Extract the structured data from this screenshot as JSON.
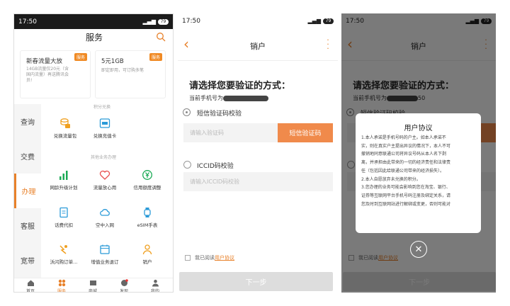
{
  "status": {
    "time": "17:50",
    "signal": "4G",
    "battery": "79"
  },
  "services": {
    "title": "服务",
    "promo1": {
      "title": "新春流量大放",
      "tag": "服务",
      "desc_line1": "14GB流量仅20元（含",
      "desc_line2": "国内流量）再送腾讯会",
      "desc_line3": "员!"
    },
    "promo2": {
      "title": "5元1GB",
      "tag": "服务",
      "desc": "即定即用，可订购多笔"
    },
    "nav": [
      "查询",
      "交费",
      "办理",
      "客服",
      "宽带"
    ],
    "sections": {
      "points": "积分兑换",
      "other": "其他业务办理"
    },
    "points_items": [
      "兑换流量包",
      "兑换充值卡"
    ],
    "items_row1": [
      "网龄升级计划",
      "流量放心用",
      "信用额度调整"
    ],
    "items_row2": [
      "话费代扣",
      "空中入网",
      "eSIM手表"
    ],
    "items_row3": [
      "沃闪购订单...",
      "增值业务退订",
      "销户"
    ],
    "tabs": [
      "首页",
      "服务",
      "商城",
      "发现",
      "我的"
    ]
  },
  "cancel": {
    "title": "销户",
    "question": "请选择您要验证的方式：",
    "phone_prefix": "当前手机号为",
    "phone_suffix": "50",
    "sms_option": "短信验证码校验",
    "sms_placeholder": "请输入验证码",
    "sms_button": "短信验证码",
    "iccid_option": "ICCID码校验",
    "iccid_placeholder": "请输入ICCID码校验",
    "agree_prefix": "我已阅读",
    "agree_link": "用户协议",
    "next": "下一步"
  },
  "dialog": {
    "title": "用户协议",
    "lines": [
      "1.本人承诺是手机号码的户主。如本人承诺不",
      "实，则在真实户主提出异议的情况下，本人不可",
      "撤销地同意联通公司将异议号码从本人名下剥",
      "离，并承担由此带来的一切的经济责任和法律责",
      "任（包括因此给联通公司带来的经济损失）。",
      "2.本人自愿放弃未兑换的积分。",
      "3.您办理的业务可能会影响到您在淘宝、银行、",
      "证券等互联网平台手机号码注册及绑定关系，请",
      "您及时到互联网站进行解绑或变更，否则可能对"
    ]
  }
}
